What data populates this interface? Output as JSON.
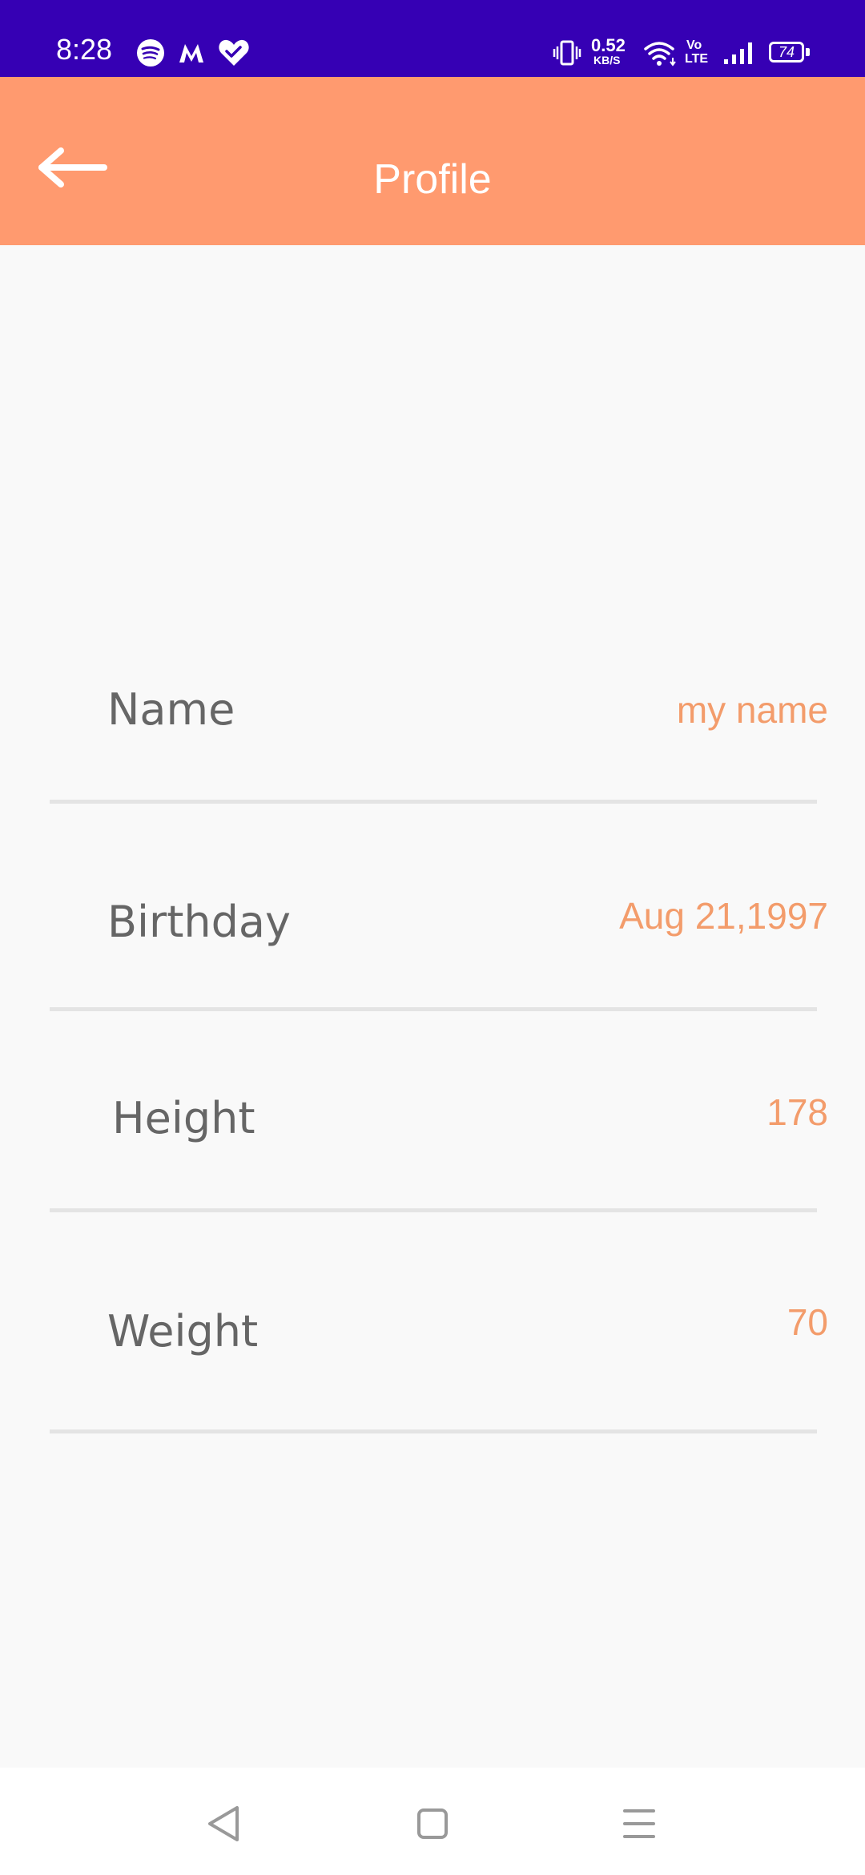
{
  "status_bar": {
    "time": "8:28",
    "app_icons": [
      "spotify-icon",
      "myntra-icon",
      "health-heart-icon"
    ],
    "network_speed_value": "0.52",
    "network_speed_unit": "KB/S",
    "volte_top": "Vo",
    "volte_bottom": "LTE",
    "battery": "74",
    "background_color": "#3600b4"
  },
  "app_bar": {
    "title": "Profile",
    "back_icon": "arrow-left-icon",
    "background_color": "#ff9a6f"
  },
  "profile": {
    "rows": [
      {
        "label": "Name",
        "value": "my name"
      },
      {
        "label": "Birthday",
        "value": "Aug 21,1997"
      },
      {
        "label": "Height",
        "value": "178"
      },
      {
        "label": "Weight",
        "value": "70"
      }
    ],
    "value_color": "#f39c6b",
    "label_color": "#666666"
  },
  "nav_bar": {
    "buttons": [
      "back-triangle-icon",
      "home-square-icon",
      "recents-menu-icon"
    ]
  }
}
